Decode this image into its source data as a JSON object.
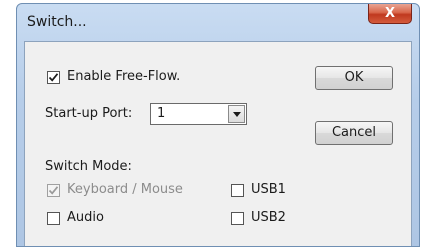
{
  "window": {
    "title": "Switch...",
    "close_glyph": "X"
  },
  "options": {
    "enable_free_flow": {
      "label": "Enable Free-Flow.",
      "checked": true
    },
    "startup_port": {
      "label": "Start-up Port:",
      "value": "1"
    }
  },
  "buttons": {
    "ok": "OK",
    "cancel": "Cancel"
  },
  "switch_mode": {
    "label": "Switch Mode:",
    "keyboard_mouse": {
      "label": "Keyboard / Mouse",
      "checked": true,
      "enabled": false
    },
    "audio": {
      "label": "Audio",
      "checked": false
    },
    "usb1": {
      "label": "USB1",
      "checked": false
    },
    "usb2": {
      "label": "USB2",
      "checked": false
    }
  },
  "colors": {
    "titlebar": "#b6cde9",
    "client": "#f0f0f0",
    "close_button": "#c0391f",
    "disabled_text": "#8c8c8c"
  }
}
